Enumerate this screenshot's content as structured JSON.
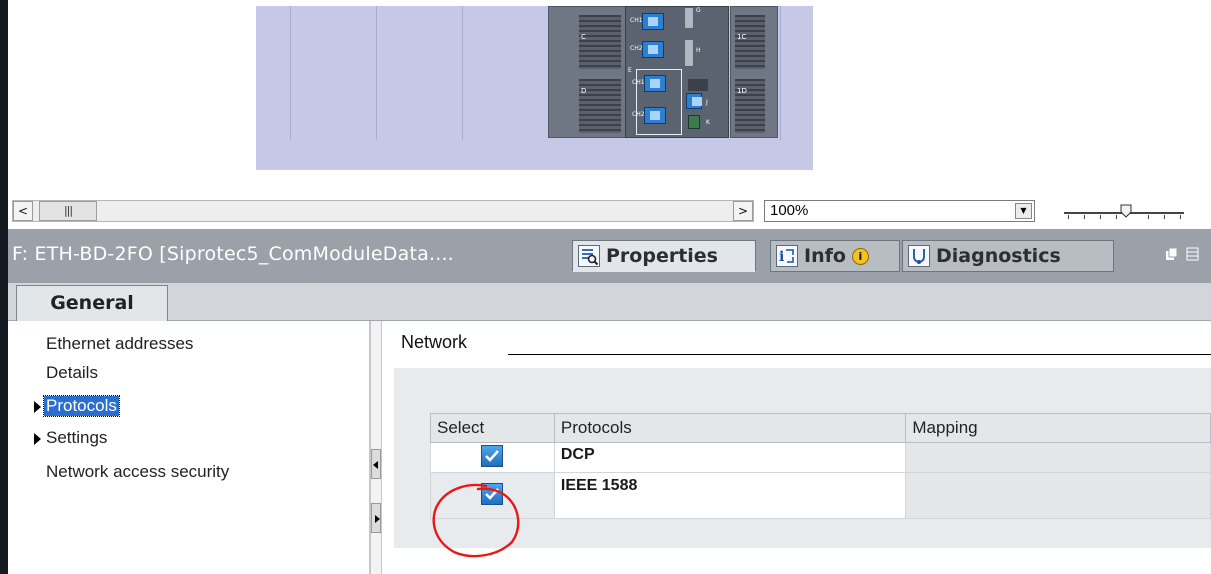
{
  "canvas": {
    "module_tags": [
      "C",
      "D",
      "E",
      "1C",
      "1D"
    ],
    "port_labels": [
      "CH1",
      "CH2",
      "CH1",
      "CH2"
    ],
    "port_letters": [
      "G",
      "H",
      "J",
      "K"
    ]
  },
  "scrollbar": {
    "left_arrow": "<",
    "thumb_grip": "|||",
    "right_arrow": ">"
  },
  "zoom": {
    "value": "100%",
    "dropdown_arrow": "▼"
  },
  "inspector": {
    "title": "F: ETH-BD-2FO [Siprotec5_ComModuleData....",
    "tabs": [
      {
        "label": "Properties",
        "icon": "properties-icon",
        "active": true
      },
      {
        "label": "Info",
        "icon": "info-icon",
        "active": false
      },
      {
        "label": "Diagnostics",
        "icon": "diagnostics-icon",
        "active": false
      }
    ],
    "info_badge": "i"
  },
  "subtabs": {
    "general": "General"
  },
  "nav": {
    "items": [
      {
        "label": "Ethernet addresses",
        "expandable": false,
        "selected": false
      },
      {
        "label": "Details",
        "expandable": false,
        "selected": false
      },
      {
        "label": "Protocols",
        "expandable": true,
        "selected": true
      },
      {
        "label": "Settings",
        "expandable": true,
        "selected": false
      },
      {
        "label": "Network access security",
        "expandable": false,
        "selected": false
      }
    ]
  },
  "network": {
    "title": "Network",
    "columns": [
      "Select",
      "Protocols",
      "Mapping"
    ],
    "rows": [
      {
        "selected": true,
        "protocol": "DCP",
        "mapping": ""
      },
      {
        "selected": true,
        "protocol": "IEEE 1588",
        "mapping": ""
      }
    ]
  },
  "colors": {
    "header_bar": "#9aa1a8",
    "selection": "#2a6ed0",
    "annotation_circle": "#e81818"
  }
}
